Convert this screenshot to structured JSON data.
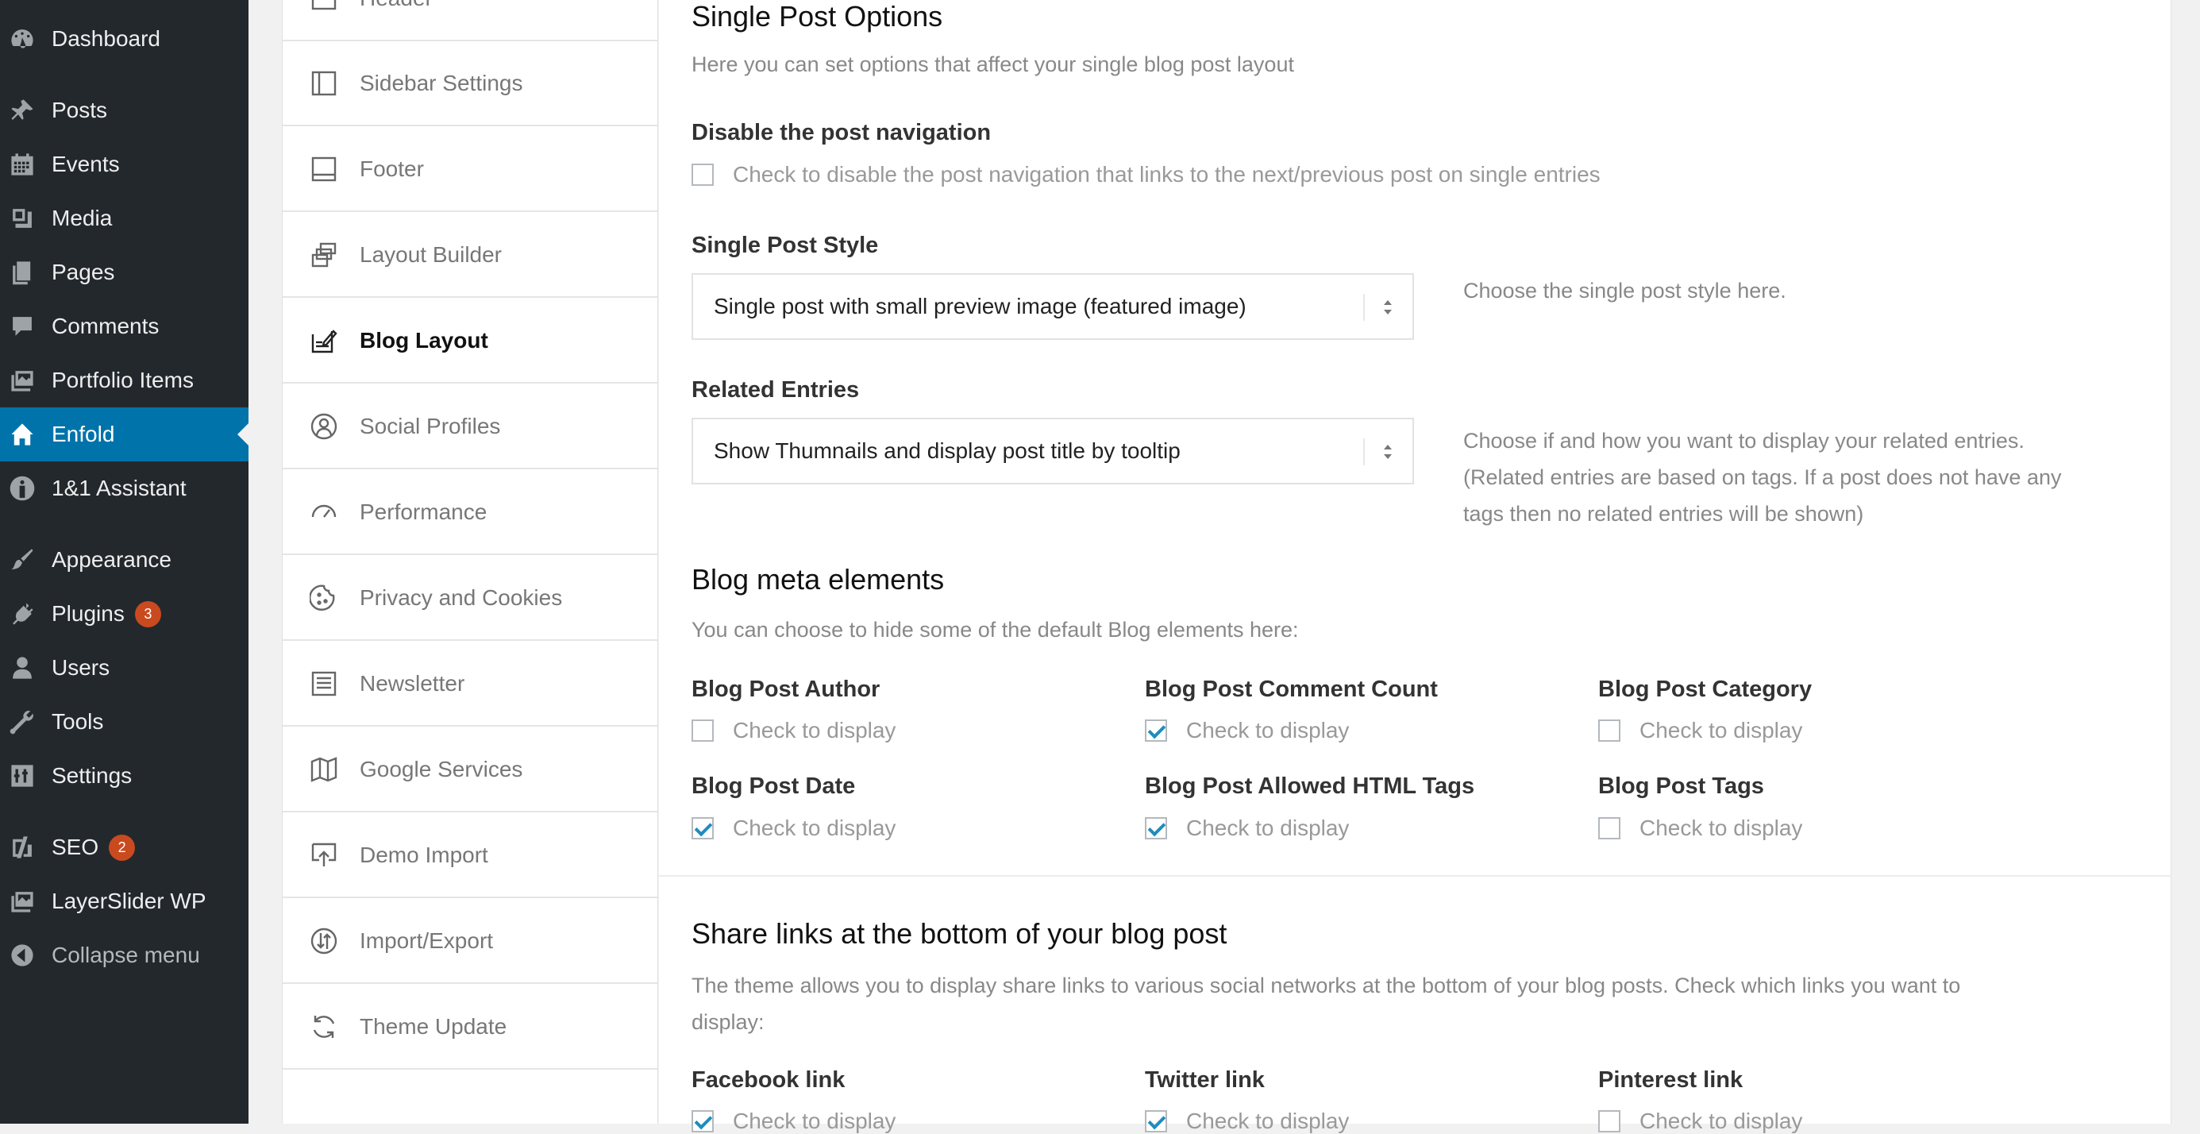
{
  "sidebar": {
    "items": [
      {
        "label": "Dashboard",
        "icon": "dashboard-icon"
      },
      {
        "label": "Posts",
        "icon": "pin-icon"
      },
      {
        "label": "Events",
        "icon": "calendar-icon"
      },
      {
        "label": "Media",
        "icon": "media-icon"
      },
      {
        "label": "Pages",
        "icon": "pages-icon"
      },
      {
        "label": "Comments",
        "icon": "comment-icon"
      },
      {
        "label": "Portfolio Items",
        "icon": "portfolio-icon"
      },
      {
        "label": "Enfold",
        "icon": "home-icon",
        "active": true
      },
      {
        "label": "1&1 Assistant",
        "icon": "assistant-icon"
      },
      {
        "label": "Appearance",
        "icon": "brush-icon"
      },
      {
        "label": "Plugins",
        "icon": "plug-icon",
        "badge": "3"
      },
      {
        "label": "Users",
        "icon": "user-icon"
      },
      {
        "label": "Tools",
        "icon": "wrench-icon"
      },
      {
        "label": "Settings",
        "icon": "sliders-icon"
      },
      {
        "label": "SEO",
        "icon": "seo-icon",
        "badge": "2"
      },
      {
        "label": "LayerSlider WP",
        "icon": "layers-icon"
      },
      {
        "label": "Collapse menu",
        "icon": "collapse-icon"
      }
    ]
  },
  "tabs": [
    {
      "label": "Header",
      "icon": "header-icon"
    },
    {
      "label": "Sidebar Settings",
      "icon": "sidebar-layout-icon"
    },
    {
      "label": "Footer",
      "icon": "footer-icon"
    },
    {
      "label": "Layout Builder",
      "icon": "layout-builder-icon"
    },
    {
      "label": "Blog Layout",
      "icon": "edit-icon",
      "active": true
    },
    {
      "label": "Social Profiles",
      "icon": "social-icon"
    },
    {
      "label": "Performance",
      "icon": "gauge-icon"
    },
    {
      "label": "Privacy and Cookies",
      "icon": "cookie-icon"
    },
    {
      "label": "Newsletter",
      "icon": "newsletter-icon"
    },
    {
      "label": "Google Services",
      "icon": "map-icon"
    },
    {
      "label": "Demo Import",
      "icon": "import-icon"
    },
    {
      "label": "Import/Export",
      "icon": "import-export-icon"
    },
    {
      "label": "Theme Update",
      "icon": "refresh-icon"
    }
  ],
  "single_post": {
    "title": "Single Post Options",
    "desc": "Here you can set options that affect your single blog post layout",
    "nav_label": "Disable the post navigation",
    "nav_check": "Check to disable the post navigation that links to the next/previous post on single entries",
    "nav_checked": false,
    "style_label": "Single Post Style",
    "style_value": "Single post with small preview image (featured image)",
    "style_help": "Choose the single post style here.",
    "related_label": "Related Entries",
    "related_value": "Show Thumnails and display post title by tooltip",
    "related_help_1": "Choose if and how you want to display your related entries.",
    "related_help_2": "(Related entries are based on tags. If a post does not have any",
    "related_help_3": "tags then no related entries will be shown)"
  },
  "meta": {
    "title": "Blog meta elements",
    "desc": "You can choose to hide some of the default Blog elements here:",
    "check_text": "Check to display",
    "items": [
      {
        "label": "Blog Post Author",
        "checked": false
      },
      {
        "label": "Blog Post Comment Count",
        "checked": true
      },
      {
        "label": "Blog Post Category",
        "checked": false
      },
      {
        "label": "Blog Post Date",
        "checked": true
      },
      {
        "label": "Blog Post Allowed HTML Tags",
        "checked": true
      },
      {
        "label": "Blog Post Tags",
        "checked": false
      }
    ]
  },
  "share": {
    "title": "Share links at the bottom of your blog post",
    "desc_1": "The theme allows you to display share links to various social networks at the bottom of your blog posts. Check which links you want to",
    "desc_2": "display:",
    "check_text": "Check to display",
    "items": [
      {
        "label": "Facebook link",
        "checked": true
      },
      {
        "label": "Twitter link",
        "checked": true
      },
      {
        "label": "Pinterest link",
        "checked": false
      }
    ]
  },
  "colors": {
    "admin_bg": "#23282d",
    "active": "#0073aa",
    "badge": "#ca4a1f",
    "check": "#1e8cbe"
  }
}
